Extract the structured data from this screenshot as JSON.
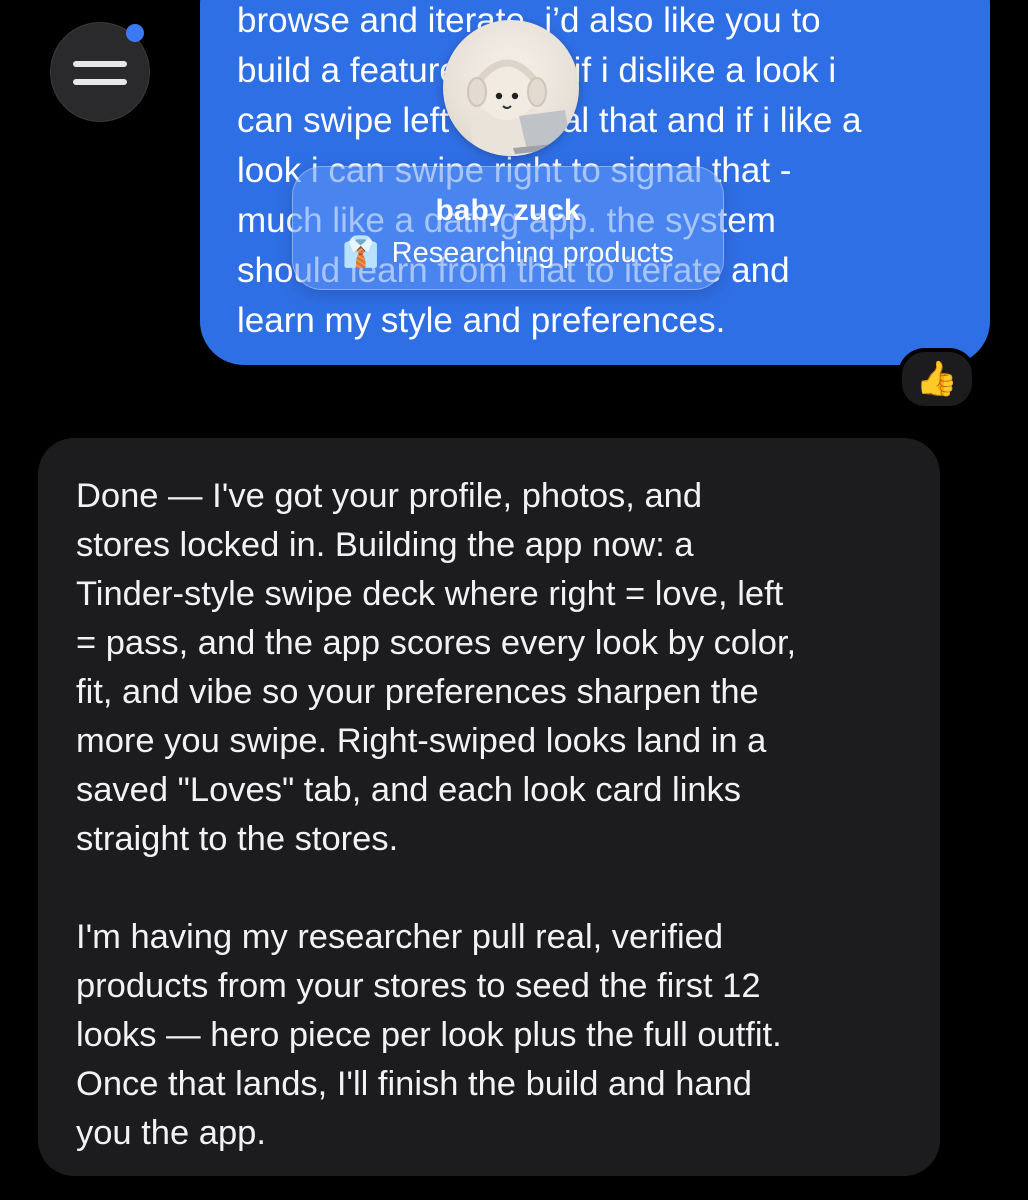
{
  "menu": {
    "icon": "hamburger-icon",
    "has_notification": true
  },
  "user_message": {
    "lines": [
      "browse and iterate. i’d also like you to",
      "build a feature where if i dislike a look i",
      "can swipe left to signal that and if i like a",
      "look i can swipe right to signal that -",
      "much like a dating app. the system",
      "should learn from that to iterate and",
      "learn my style and preferences."
    ],
    "reaction": "👍"
  },
  "agent": {
    "name": "baby zuck",
    "status_icon": "tie-icon",
    "status_emoji": "👔",
    "status": "Researching products"
  },
  "assistant_message": {
    "paragraph1": [
      "Done — I've got your profile, photos, and",
      "stores locked in. Building the app now: a",
      "Tinder-style swipe deck where right = love, left",
      "= pass, and the app scores every look by color,",
      "fit, and vibe so your preferences sharpen the",
      "more you swipe. Right-swiped looks land in a",
      "saved \"Loves\" tab, and each look card links",
      "straight to the stores."
    ],
    "paragraph2": [
      "I'm having my researcher pull real, verified",
      "products from your stores to seed the first 12",
      "looks — hero piece per look plus the full outfit.",
      "Once that lands, I'll finish the build and hand",
      "you the app."
    ]
  },
  "colors": {
    "background": "#000000",
    "user_bubble": "#2f6fe6",
    "assistant_bubble": "#1c1c1e",
    "notification_dot": "#3b7af2"
  }
}
